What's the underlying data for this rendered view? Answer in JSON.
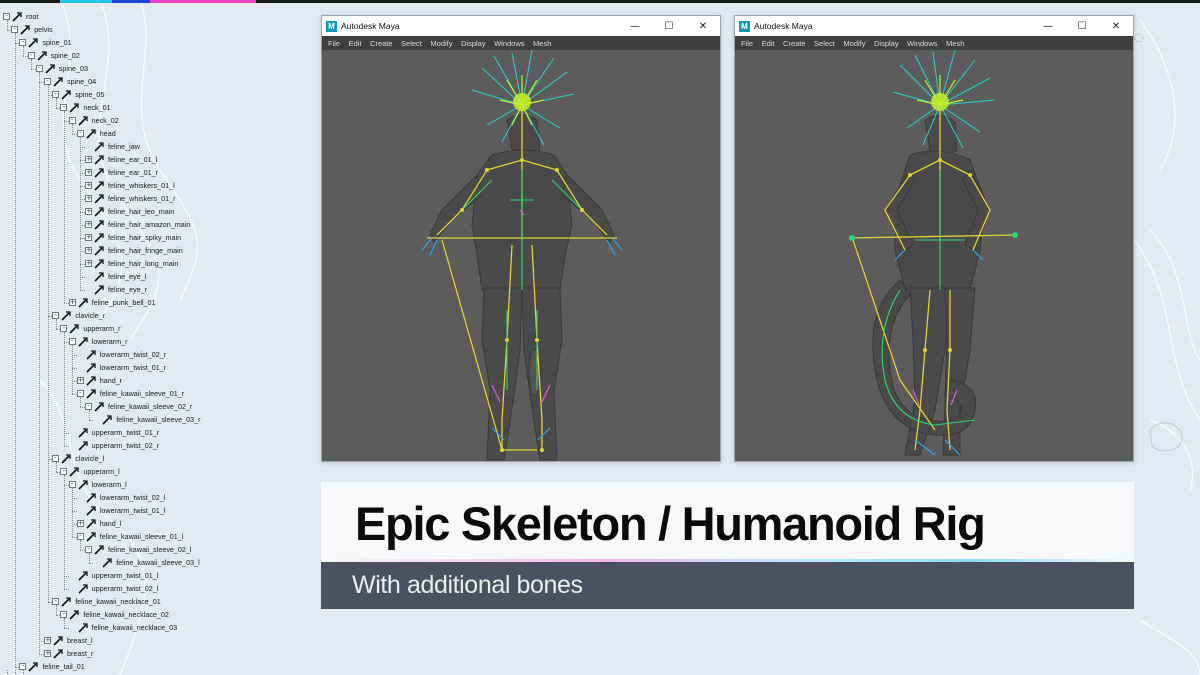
{
  "accent_colors": [
    "#1ec9e8",
    "#2442d8",
    "#e83fc4"
  ],
  "outliner": {
    "items": [
      {
        "label": "root",
        "depth": 0,
        "exp": "-"
      },
      {
        "label": "pelvis",
        "depth": 1,
        "exp": "-"
      },
      {
        "label": "spine_01",
        "depth": 2,
        "exp": "-"
      },
      {
        "label": "spine_02",
        "depth": 3,
        "exp": "-"
      },
      {
        "label": "spine_03",
        "depth": 4,
        "exp": "-"
      },
      {
        "label": "spine_04",
        "depth": 5,
        "exp": "-"
      },
      {
        "label": "spine_05",
        "depth": 6,
        "exp": "-"
      },
      {
        "label": "neck_01",
        "depth": 7,
        "exp": "-"
      },
      {
        "label": "neck_02",
        "depth": 8,
        "exp": "-"
      },
      {
        "label": "head",
        "depth": 9,
        "exp": "-"
      },
      {
        "label": "feline_jaw",
        "depth": 10,
        "exp": ""
      },
      {
        "label": "feline_ear_01_l",
        "depth": 10,
        "exp": "+"
      },
      {
        "label": "feline_ear_01_r",
        "depth": 10,
        "exp": "+"
      },
      {
        "label": "feline_whiskers_01_l",
        "depth": 10,
        "exp": "+"
      },
      {
        "label": "feline_whiskers_01_r",
        "depth": 10,
        "exp": "+"
      },
      {
        "label": "feline_hair_leo_main",
        "depth": 10,
        "exp": "+"
      },
      {
        "label": "feline_hair_amazon_main",
        "depth": 10,
        "exp": "+"
      },
      {
        "label": "feline_hair_spiky_main",
        "depth": 10,
        "exp": "+"
      },
      {
        "label": "feline_hair_fringe_main",
        "depth": 10,
        "exp": "+"
      },
      {
        "label": "feline_hair_long_main",
        "depth": 10,
        "exp": "+"
      },
      {
        "label": "feline_eye_l",
        "depth": 10,
        "exp": ""
      },
      {
        "label": "feline_eye_r",
        "depth": 10,
        "exp": ""
      },
      {
        "label": "feline_punk_bell_01",
        "depth": 8,
        "exp": "+"
      },
      {
        "label": "clavicle_r",
        "depth": 6,
        "exp": "-"
      },
      {
        "label": "upperarm_r",
        "depth": 7,
        "exp": "-"
      },
      {
        "label": "lowerarm_r",
        "depth": 8,
        "exp": "-"
      },
      {
        "label": "lowerarm_twist_02_r",
        "depth": 9,
        "exp": ""
      },
      {
        "label": "lowerarm_twist_01_r",
        "depth": 9,
        "exp": ""
      },
      {
        "label": "hand_r",
        "depth": 9,
        "exp": "+"
      },
      {
        "label": "feline_kawaii_sleeve_01_r",
        "depth": 9,
        "exp": "-"
      },
      {
        "label": "feline_kawaii_sleeve_02_r",
        "depth": 10,
        "exp": "-"
      },
      {
        "label": "feline_kawaii_sleeve_03_r",
        "depth": 11,
        "exp": ""
      },
      {
        "label": "upperarm_twist_01_r",
        "depth": 8,
        "exp": ""
      },
      {
        "label": "upperarm_twist_02_r",
        "depth": 8,
        "exp": ""
      },
      {
        "label": "clavicle_l",
        "depth": 6,
        "exp": "-"
      },
      {
        "label": "upperarm_l",
        "depth": 7,
        "exp": "-"
      },
      {
        "label": "lowerarm_l",
        "depth": 8,
        "exp": "-"
      },
      {
        "label": "lowerarm_twist_02_l",
        "depth": 9,
        "exp": ""
      },
      {
        "label": "lowerarm_twist_01_l",
        "depth": 9,
        "exp": ""
      },
      {
        "label": "hand_l",
        "depth": 9,
        "exp": "+"
      },
      {
        "label": "feline_kawaii_sleeve_01_l",
        "depth": 9,
        "exp": "-"
      },
      {
        "label": "feline_kawaii_sleeve_02_l",
        "depth": 10,
        "exp": "-"
      },
      {
        "label": "feline_kawaii_sleeve_03_l",
        "depth": 11,
        "exp": ""
      },
      {
        "label": "upperarm_twist_01_l",
        "depth": 8,
        "exp": ""
      },
      {
        "label": "upperarm_twist_02_l",
        "depth": 8,
        "exp": ""
      },
      {
        "label": "feline_kawaii_necklace_01",
        "depth": 6,
        "exp": "-"
      },
      {
        "label": "feline_kawaii_necklace_02",
        "depth": 7,
        "exp": "-"
      },
      {
        "label": "feline_kawaii_necklace_03",
        "depth": 8,
        "exp": ""
      },
      {
        "label": "breast_l",
        "depth": 5,
        "exp": "+"
      },
      {
        "label": "breast_r",
        "depth": 5,
        "exp": "+"
      },
      {
        "label": "feline_tail_01",
        "depth": 2,
        "exp": "-"
      }
    ]
  },
  "windows": [
    {
      "logo": "M",
      "title": "Autodesk Maya",
      "controls": {
        "minimize": "—",
        "maximize": "☐",
        "close": "✕"
      },
      "menu": [
        "File",
        "Edit",
        "Create",
        "Select",
        "Modify",
        "Display",
        "Windows",
        "Mesh"
      ],
      "view": "front"
    },
    {
      "logo": "M",
      "title": "Autodesk Maya",
      "controls": {
        "minimize": "—",
        "maximize": "☐",
        "close": "✕"
      },
      "menu": [
        "File",
        "Edit",
        "Create",
        "Select",
        "Modify",
        "Display",
        "Windows",
        "Mesh"
      ],
      "view": "side"
    }
  ],
  "title_card": {
    "title": "Epic Skeleton / Humanoid Rig",
    "subtitle": "With additional bones"
  }
}
